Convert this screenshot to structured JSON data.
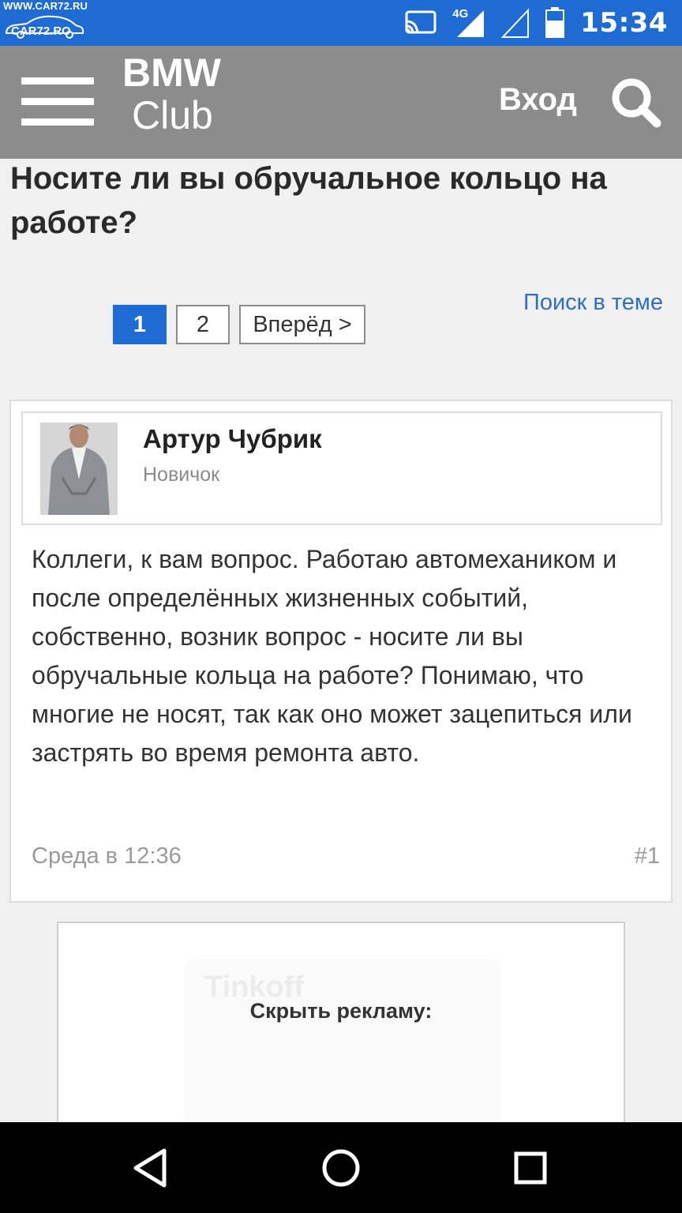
{
  "status_bar": {
    "watermark_url": "WWW.CAR72.RU",
    "watermark_logo": "CAR72.RO",
    "network": "4G",
    "time": "15:34",
    "icons": [
      "cast-icon",
      "signal-icon",
      "signal-empty-icon",
      "battery-icon"
    ]
  },
  "header": {
    "brand_line1": "BMW",
    "brand_line2": "Club",
    "login_label": "Вход",
    "icons": [
      "menu-icon",
      "search-icon"
    ]
  },
  "topic": {
    "title": "Носите ли вы обручальное кольцо на работе?"
  },
  "pagination": {
    "pages": [
      "1",
      "2"
    ],
    "current": "1",
    "next_label": "Вперёд >",
    "search_in_topic": "Поиск в теме"
  },
  "post": {
    "author_name": "Артур Чубрик",
    "author_rank": "Новичок",
    "body": "Коллеги, к вам вопрос. Работаю автомехаником и после определённых жизненных событий, собственно, возник вопрос - носите ли вы обручальные кольца на работе? Понимаю, что многие не носят, так как оно может зацепиться или застрять во время ремонта авто.",
    "date": "Среда в 12:36",
    "number": "#1"
  },
  "ad": {
    "hide_label": "Скрыть рекламу:",
    "background_text": "Tinkoff"
  },
  "nav_bar": {
    "icons": [
      "back-icon",
      "home-icon",
      "recents-icon"
    ]
  },
  "colors": {
    "status_bar": "#1d6bd3",
    "header": "#8c8c8c",
    "accent": "#1d6bd3",
    "link": "#2f6fc0"
  }
}
